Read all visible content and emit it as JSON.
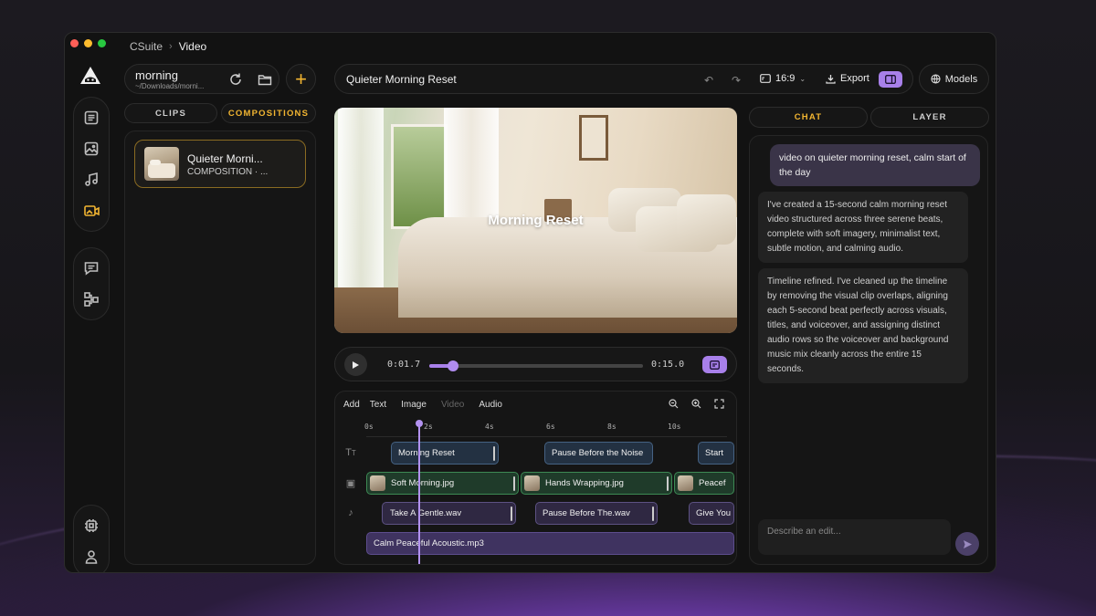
{
  "breadcrumb": {
    "app": "CSuite",
    "page": "Video"
  },
  "project": {
    "name": "morning",
    "path": "~/Downloads/morni..."
  },
  "left_tabs": [
    {
      "label": "CLIPS",
      "active": false
    },
    {
      "label": "COMPOSITIONS",
      "active": true
    }
  ],
  "composition_card": {
    "title": "Quieter Morni...",
    "subtitle": "COMPOSITION · ..."
  },
  "topbar": {
    "title": "Quieter Morning Reset",
    "ratio": "16:9",
    "export_label": "Export"
  },
  "models_label": "Models",
  "preview": {
    "overlay_title": "Morning Reset"
  },
  "player": {
    "current_time": "0:01.7",
    "duration": "0:15.0",
    "progress": 0.113
  },
  "timeline": {
    "toolbar": {
      "add": "Add",
      "text": "Text",
      "image": "Image",
      "video": "Video",
      "audio": "Audio"
    },
    "ruler": [
      "0s",
      "2s",
      "4s",
      "6s",
      "8s",
      "10s"
    ],
    "text_clips": [
      "Morning Reset",
      "Pause Before the Noise",
      "Start"
    ],
    "image_clips": [
      "Soft Morning.jpg",
      "Hands Wrapping.jpg",
      "Peacef"
    ],
    "voice_clips": [
      "Take A Gentle.wav",
      "Pause Before The.wav",
      "Give You"
    ],
    "music_clip": "Calm Peaceful Acoustic.mp3"
  },
  "right_tabs": [
    {
      "label": "CHAT",
      "active": true
    },
    {
      "label": "LAYER",
      "active": false
    }
  ],
  "chat": {
    "user_message": "video on quieter morning reset, calm start of the day",
    "assistant_messages": [
      "I've created a 15-second calm morning reset video structured across three serene beats, complete with soft imagery, minimalist text, subtle motion, and calming audio.",
      "Timeline refined. I've cleaned up the timeline by removing the visual clip overlaps, aligning each 5-second beat perfectly across visuals, titles, and voiceover, and assigning distinct audio rows so the voiceover and background music mix cleanly across the entire 15 seconds."
    ],
    "input_placeholder": "Describe an edit..."
  },
  "colors": {
    "accent": "#f2b531",
    "purple": "#a880ea",
    "window_bg": "#121212"
  }
}
